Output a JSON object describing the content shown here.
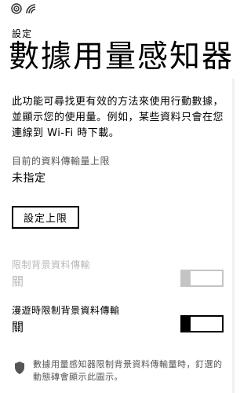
{
  "status_bar": {
    "icons": [
      "signal-icon",
      "wifi-icon"
    ]
  },
  "header": {
    "app_name": "設定",
    "title": "數據用量感知器"
  },
  "main": {
    "description": "此功能可尋找更有效的方法來使用行動數據，並顯示您的使用量。例如，某些資料只會在您連線到 Wi-Fi 時下載。",
    "limit_label": "目前的資料傳輸量上限",
    "limit_value": "未指定",
    "set_limit_button": "設定上限"
  },
  "settings": [
    {
      "label": "限制背景資料傳輸",
      "state": "關",
      "enabled": false
    },
    {
      "label": "漫遊時限制背景資料傳輸",
      "state": "關",
      "enabled": true
    }
  ],
  "footer": {
    "note": "數據用量感知器限制背景資料傳輸量時，釘選的動態磚會顯示此圖示。",
    "icon": "shield-icon"
  },
  "colors": {
    "text": "#000000",
    "secondary_text": "#555555",
    "disabled": "#b8b8b8",
    "background": "#ffffff"
  }
}
